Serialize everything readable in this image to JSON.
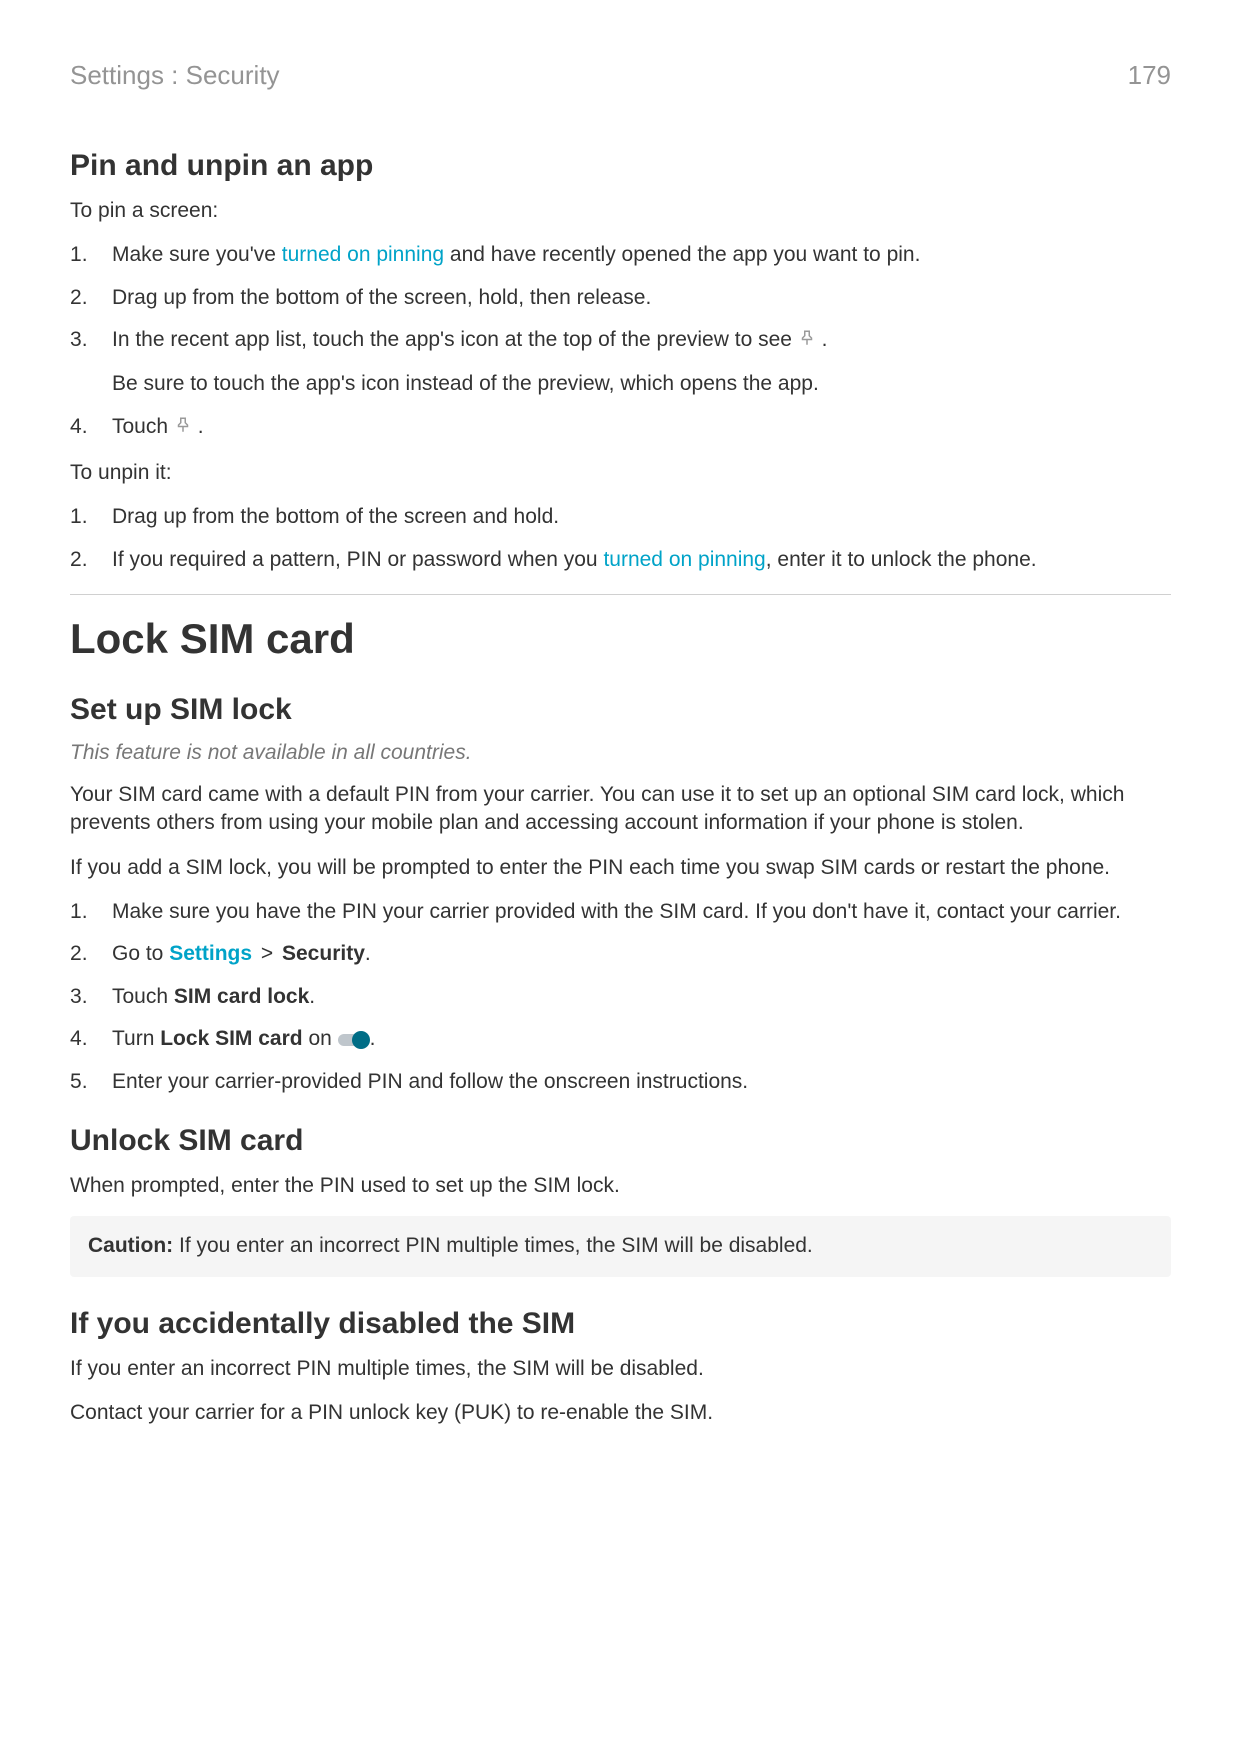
{
  "header": {
    "breadcrumb": "Settings : Security",
    "page_number": "179"
  },
  "pin_section": {
    "heading": "Pin and unpin an app",
    "intro": "To pin a screen:",
    "step1_a": "Make sure you've ",
    "step1_link": "turned on pinning",
    "step1_b": " and have recently opened the app you want to pin.",
    "step2": "Drag up from the bottom of the screen, hold, then release.",
    "step3": "In the recent app list, touch the app's icon at the top of the preview to see ",
    "step3_dot": ".",
    "step3_sub": "Be sure to touch the app's icon instead of the preview, which opens the app.",
    "step4_a": "Touch ",
    "step4_b": ".",
    "unpin_intro": "To unpin it:",
    "unpin1": "Drag up from the bottom of the screen and hold.",
    "unpin2_a": "If you required a pattern, PIN or password when you ",
    "unpin2_link": "turned on pinning",
    "unpin2_b": ", enter it to unlock the phone."
  },
  "lock_sim": {
    "title": "Lock SIM card",
    "setup_heading": "Set up SIM lock",
    "note": "This feature is not available in all countries.",
    "para1": "Your SIM card came with a default PIN from your carrier. You can use it to set up an optional SIM card lock, which prevents others from using your mobile plan and accessing account information if your phone is stolen.",
    "para2": "If you add a SIM lock, you will be prompted to enter the PIN each time you swap SIM cards or restart the phone.",
    "step1": "Make sure you have the PIN your carrier provided with the SIM card. If you don't have it, contact your carrier.",
    "step2_a": "Go to ",
    "step2_link": "Settings",
    "step2_gt": ">",
    "step2_bold": "Security",
    "step2_dot": ".",
    "step3_a": "Touch ",
    "step3_bold": "SIM card lock",
    "step3_dot": ".",
    "step4_a": "Turn ",
    "step4_bold": "Lock SIM card",
    "step4_b": " on ",
    "step4_dot": ".",
    "step5": "Enter your carrier-provided PIN and follow the onscreen instructions.",
    "unlock_heading": "Unlock SIM card",
    "unlock_para": "When prompted, enter the PIN used to set up the SIM lock.",
    "caution_label": "Caution:",
    "caution_body": " If you enter an incorrect PIN multiple times, the SIM will be disabled.",
    "accident_heading": "If you accidentally disabled the SIM",
    "accident_p1": "If you enter an incorrect PIN multiple times, the SIM will be disabled.",
    "accident_p2": "Contact your carrier for a PIN unlock key (PUK) to re-enable the SIM."
  },
  "icons": {
    "pin": "push-pin-icon",
    "toggle_on": "toggle-on-icon"
  }
}
